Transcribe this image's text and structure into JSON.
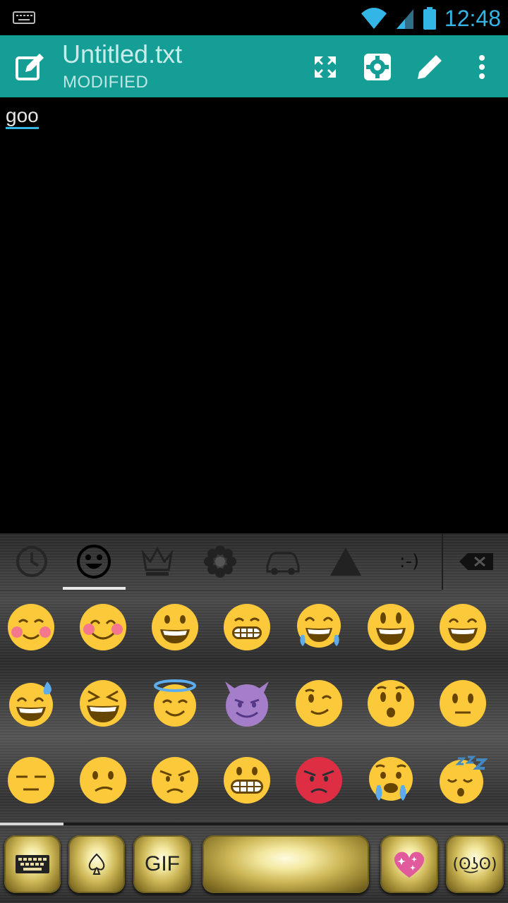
{
  "status_bar": {
    "time": "12:48"
  },
  "action_bar": {
    "title": "Untitled.txt",
    "subtitle": "MODIFIED",
    "icons": [
      "edit-icon",
      "fullscreen-icon",
      "settings-icon",
      "pencil-icon",
      "overflow-icon"
    ]
  },
  "editor": {
    "text": "goo"
  },
  "keyboard": {
    "categories": [
      "recent-icon",
      "smiley-icon",
      "crown-icon",
      "flower-icon",
      "car-icon",
      "triangle-icon",
      "emoticon-text",
      "backspace-icon"
    ],
    "emoticon_category_label": ":-)",
    "emoji_names": [
      "smiling-blush",
      "smiling-eyes-blush",
      "grinning-face",
      "grimace-grin",
      "tears-of-joy",
      "smiley-open",
      "grin-squint",
      "sweat-smile",
      "laughing-squint",
      "halo-smile",
      "smiling-devil",
      "winking-face",
      "hushed-face",
      "neutral-face",
      "expressionless",
      "confused-face",
      "angry-face",
      "grimacing-face",
      "pouting-face",
      "crying-face",
      "sleeping-face"
    ],
    "bottom_keys": {
      "gif": "GIF",
      "kaomoji": "(ʘ͜ʖʘ)"
    }
  },
  "colors": {
    "action_bar": "#159e96",
    "accent": "#33b5e5",
    "emoji_yellow": "#fcc93a",
    "devil_purple": "#a47ec9",
    "pouting_red": "#dd2e44"
  }
}
